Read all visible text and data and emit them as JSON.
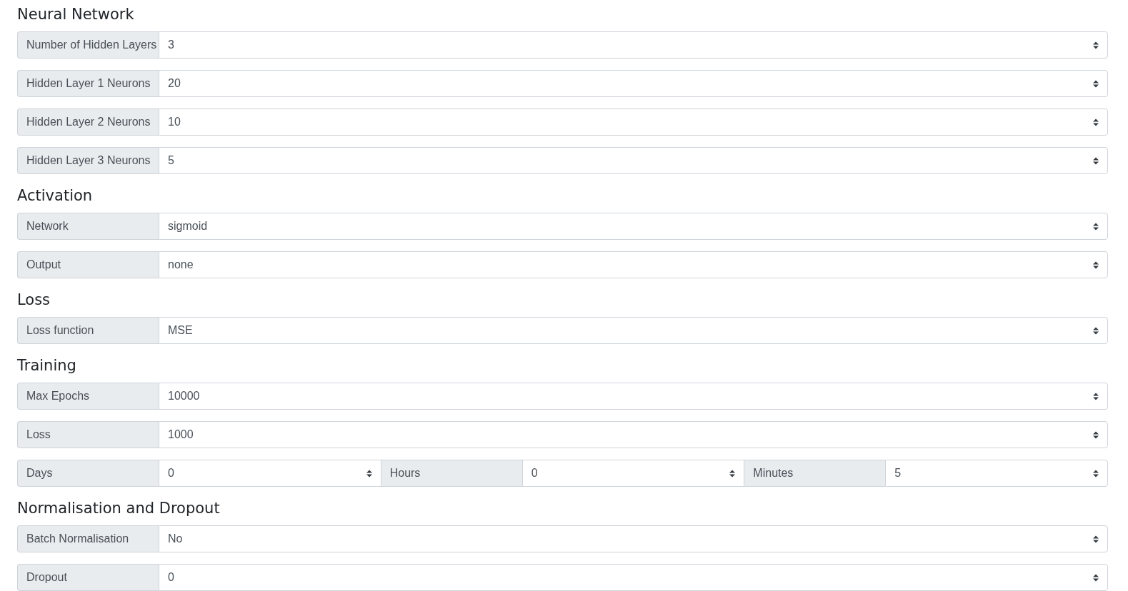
{
  "sections": [
    {
      "title": "Neural Network",
      "rows": [
        {
          "fields": [
            {
              "label": "Number of Hidden Layers",
              "value": "3"
            }
          ]
        },
        {
          "fields": [
            {
              "label": "Hidden Layer 1 Neurons",
              "value": "20"
            }
          ]
        },
        {
          "fields": [
            {
              "label": "Hidden Layer 2 Neurons",
              "value": "10"
            }
          ]
        },
        {
          "fields": [
            {
              "label": "Hidden Layer 3 Neurons",
              "value": "5"
            }
          ]
        }
      ]
    },
    {
      "title": "Activation",
      "rows": [
        {
          "fields": [
            {
              "label": "Network",
              "value": "sigmoid"
            }
          ]
        },
        {
          "fields": [
            {
              "label": "Output",
              "value": "none"
            }
          ]
        }
      ]
    },
    {
      "title": "Loss",
      "rows": [
        {
          "fields": [
            {
              "label": "Loss function",
              "value": "MSE"
            }
          ]
        }
      ]
    },
    {
      "title": "Training",
      "rows": [
        {
          "fields": [
            {
              "label": "Max Epochs",
              "value": "10000"
            }
          ]
        },
        {
          "fields": [
            {
              "label": "Loss",
              "value": "1000"
            }
          ]
        },
        {
          "fields": [
            {
              "label": "Days",
              "value": "0"
            },
            {
              "label": "Hours",
              "value": "0"
            },
            {
              "label": "Minutes",
              "value": "5"
            }
          ]
        }
      ]
    },
    {
      "title": "Normalisation and Dropout",
      "rows": [
        {
          "fields": [
            {
              "label": "Batch Normalisation",
              "value": "No"
            }
          ]
        },
        {
          "fields": [
            {
              "label": "Dropout",
              "value": "0"
            }
          ]
        }
      ]
    }
  ]
}
